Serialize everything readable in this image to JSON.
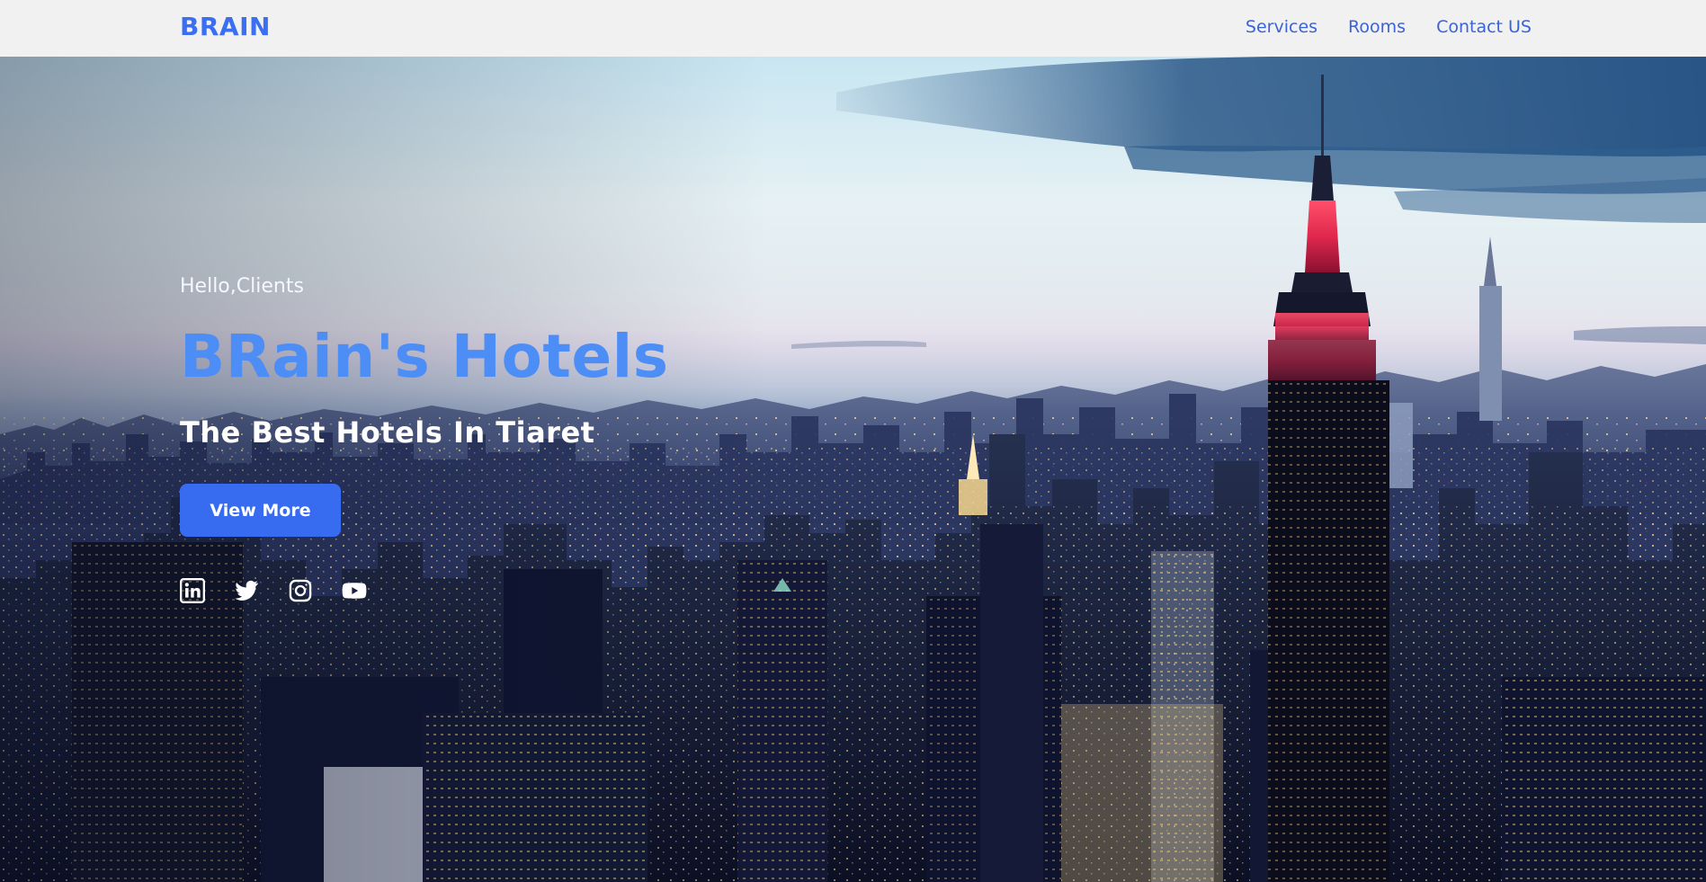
{
  "nav": {
    "brand": "BRAIN",
    "links": [
      "Services",
      "Rooms",
      "Contact US"
    ]
  },
  "hero": {
    "greeting": "Hello,Clients",
    "title": "BRain's Hotels",
    "subtitle": "The Best Hotels In Tiaret",
    "cta_label": "View More",
    "background": "city-skyline-at-dusk",
    "socials": [
      "linkedin-icon",
      "twitter-icon",
      "instagram-icon",
      "youtube-icon"
    ]
  },
  "colors": {
    "accent": "#386cf0",
    "brand": "#3a6ef3",
    "title": "#4d8df6",
    "nav_bg": "#f1f1f1",
    "nav_link": "#3a63d8"
  }
}
